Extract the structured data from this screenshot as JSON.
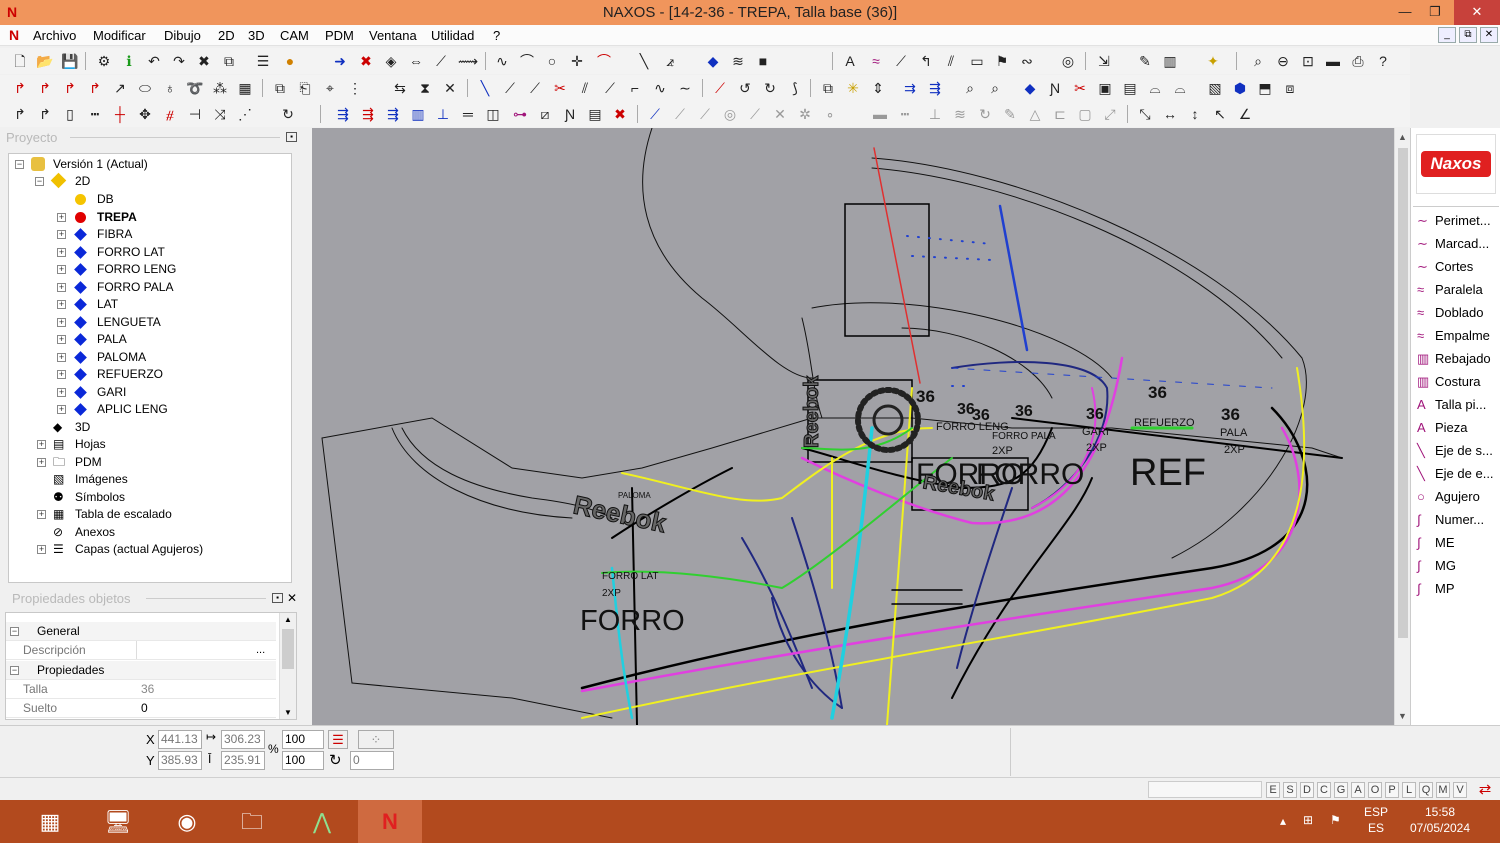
{
  "window": {
    "title": "NAXOS - [14-2-36 - TREPA, Talla base (36)]",
    "minimize": "—",
    "restore": "❐",
    "close": "✕"
  },
  "menu": {
    "items": [
      "Archivo",
      "Modificar",
      "Dibujo",
      "2D",
      "3D",
      "CAM",
      "PDM",
      "Ventana",
      "Utilidad",
      "?"
    ],
    "mdi": [
      "_",
      "⧉",
      "✕"
    ]
  },
  "project_panel": {
    "title": "Proyecto"
  },
  "tree": {
    "root": "Versión 1 (Actual)",
    "twod": "2D",
    "layers": [
      {
        "label": "DB",
        "color": "#f5c400",
        "shape": "circle"
      },
      {
        "label": "TREPA",
        "color": "#e00000",
        "shape": "circle",
        "bold": true
      },
      {
        "label": "FIBRA",
        "color": "#0a28d8",
        "shape": "diamond"
      },
      {
        "label": "FORRO LAT",
        "color": "#0a28d8",
        "shape": "diamond"
      },
      {
        "label": "FORRO LENG",
        "color": "#0a28d8",
        "shape": "diamond"
      },
      {
        "label": "FORRO PALA",
        "color": "#0a28d8",
        "shape": "diamond"
      },
      {
        "label": "LAT",
        "color": "#0a28d8",
        "shape": "diamond"
      },
      {
        "label": "LENGUETA",
        "color": "#0a28d8",
        "shape": "diamond"
      },
      {
        "label": "PALA",
        "color": "#0a28d8",
        "shape": "diamond"
      },
      {
        "label": "PALOMA",
        "color": "#0a28d8",
        "shape": "diamond"
      },
      {
        "label": "REFUERZO",
        "color": "#0a28d8",
        "shape": "diamond"
      },
      {
        "label": "GARI",
        "color": "#0a28d8",
        "shape": "diamond"
      },
      {
        "label": "APLIC LENG",
        "color": "#0a28d8",
        "shape": "diamond"
      }
    ],
    "other": [
      "3D",
      "Hojas",
      "PDM",
      "Imágenes",
      "Símbolos",
      "Tabla de escalado",
      "Anexos",
      "Capas (actual Agujeros)"
    ]
  },
  "properties_panel": {
    "title": "Propiedades objetos",
    "sections": [
      "General",
      "Propiedades"
    ],
    "rows": [
      {
        "label": "Descripción",
        "value": "",
        "button": "..."
      },
      {
        "label": "Talla",
        "value": "36"
      },
      {
        "label": "Suelto",
        "value": "0"
      }
    ]
  },
  "right_panel": {
    "logo": "Naxos",
    "items": [
      {
        "label": "Perimet...",
        "icon": "∼"
      },
      {
        "label": "Marcad...",
        "icon": "∼"
      },
      {
        "label": "Cortes",
        "icon": "∼"
      },
      {
        "label": "Paralela",
        "icon": "≈"
      },
      {
        "label": "Doblado",
        "icon": "≈"
      },
      {
        "label": "Empalme",
        "icon": "≈"
      },
      {
        "label": "Rebajado",
        "icon": "▥"
      },
      {
        "label": "Costura",
        "icon": "▥"
      },
      {
        "label": "Talla pi...",
        "icon": "A"
      },
      {
        "label": "Pieza",
        "icon": "A"
      },
      {
        "label": "Eje de s...",
        "icon": "╲"
      },
      {
        "label": "Eje de e...",
        "icon": "╲"
      },
      {
        "label": "Agujero",
        "icon": "○"
      },
      {
        "label": "Numer...",
        "icon": "∫"
      },
      {
        "label": "ME",
        "icon": "∫"
      },
      {
        "label": "MG",
        "icon": "∫"
      },
      {
        "label": "MP",
        "icon": "∫"
      }
    ]
  },
  "coords": {
    "x_label": "X",
    "y_label": "Y",
    "x": "441.13",
    "y": "385.93",
    "w": "306.23",
    "h": "235.91",
    "sx": "100",
    "sy": "100",
    "pct": "%",
    "rot": "0"
  },
  "status": {
    "letters": [
      "E",
      "S",
      "D",
      "C",
      "G",
      "A",
      "O",
      "P",
      "L",
      "Q",
      "M",
      "V"
    ]
  },
  "drawing": {
    "labels": [
      {
        "t": "36"
      },
      {
        "t": "36"
      },
      {
        "t": "36"
      },
      {
        "t": "36"
      },
      {
        "t": "36"
      },
      {
        "t": "36"
      },
      {
        "t": "36"
      },
      {
        "t": "REFUERZO"
      },
      {
        "t": "PALA"
      },
      {
        "t": "2XP"
      },
      {
        "t": "GARI"
      },
      {
        "t": "2XP"
      },
      {
        "t": "FORRO LENG"
      },
      {
        "t": "FORRO PALA"
      },
      {
        "t": "2XP"
      },
      {
        "t": "PALOMA"
      },
      {
        "t": "FORRO LAT"
      },
      {
        "t": "2XP"
      },
      {
        "t": "FORRO"
      },
      {
        "t": "FORRO"
      },
      {
        "t": "FORRO"
      },
      {
        "t": "REF"
      },
      {
        "t": "Reebok"
      },
      {
        "t": "Reebok"
      },
      {
        "t": "Reebok"
      }
    ]
  },
  "taskbar": {
    "lang1": "ESP",
    "lang2": "ES",
    "time": "15:58",
    "date": "07/05/2024"
  }
}
